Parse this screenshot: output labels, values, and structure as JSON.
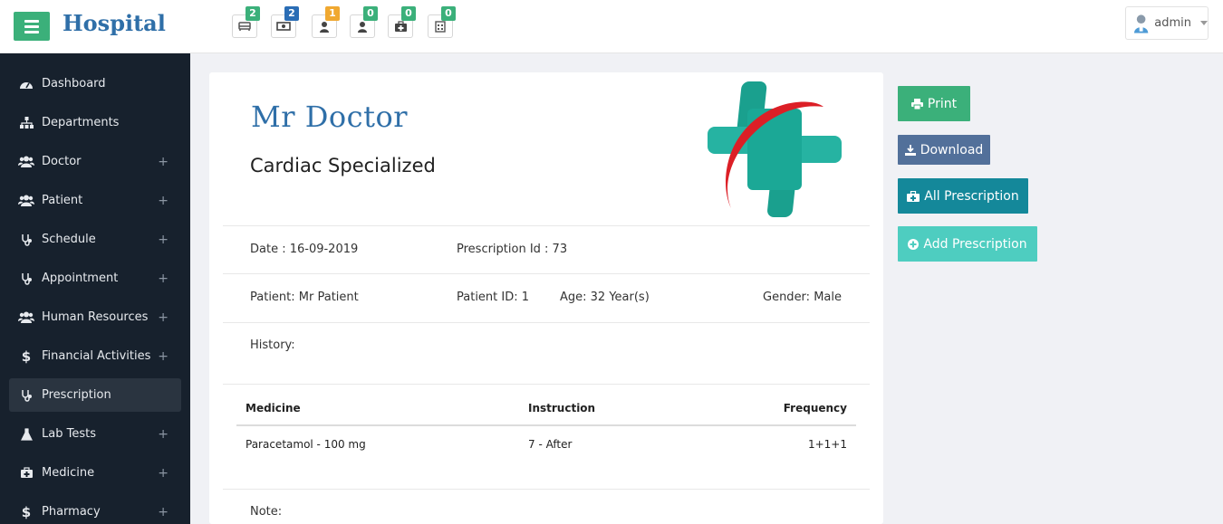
{
  "app": {
    "brand": "Hospital"
  },
  "header": {
    "badges": [
      {
        "count": "2",
        "icon": "bed-icon",
        "color": "#3bb07a"
      },
      {
        "count": "2",
        "icon": "money-icon",
        "color": "#2a6db5"
      },
      {
        "count": "1",
        "icon": "user-icon",
        "color": "#f0a830"
      },
      {
        "count": "0",
        "icon": "user-icon",
        "color": "#3bb07a"
      },
      {
        "count": "0",
        "icon": "medkit-icon",
        "color": "#3bb07a"
      },
      {
        "count": "0",
        "icon": "hospital-icon",
        "color": "#3bb07a"
      }
    ],
    "user": {
      "name": "admin"
    }
  },
  "sidebar": {
    "items": [
      {
        "label": "Dashboard",
        "icon": "dashboard-icon"
      },
      {
        "label": "Departments",
        "icon": "sitemap-icon"
      },
      {
        "label": "Doctor",
        "icon": "users-icon",
        "expandable": "+"
      },
      {
        "label": "Patient",
        "icon": "users-icon",
        "expandable": "+"
      },
      {
        "label": "Schedule",
        "icon": "stethoscope-icon",
        "expandable": "+"
      },
      {
        "label": "Appointment",
        "icon": "stethoscope-icon",
        "expandable": "+"
      },
      {
        "label": "Human Resources",
        "icon": "users-icon",
        "expandable": "+"
      },
      {
        "label": "Financial Activities",
        "icon": "dollar-icon",
        "expandable": "+"
      },
      {
        "label": "Prescription",
        "icon": "stethoscope-icon",
        "active": true
      },
      {
        "label": "Lab Tests",
        "icon": "flask-icon",
        "expandable": "+"
      },
      {
        "label": "Medicine",
        "icon": "medkit-icon",
        "expandable": "+"
      },
      {
        "label": "Pharmacy",
        "icon": "dollar-icon",
        "expandable": "+"
      }
    ]
  },
  "prescription": {
    "doctor_name": "Mr Doctor",
    "specialization": "Cardiac Specialized",
    "date": "Date : 16-09-2019",
    "prescription_id": "Prescription Id : 73",
    "patient": "Patient: Mr Patient",
    "patient_id": "Patient ID: 1",
    "age": "Age: 32 Year(s)",
    "gender": "Gender: Male",
    "history": "History:",
    "note": "Note:",
    "table": {
      "headers": [
        "Medicine",
        "Instruction",
        "Frequency"
      ],
      "rows": [
        [
          "Paracetamol - 100 mg",
          "7 - After",
          "1+1+1"
        ]
      ]
    }
  },
  "actions": {
    "print": {
      "label": "Print",
      "color": "#3bb07a"
    },
    "download": {
      "label": "Download",
      "color": "#52709a"
    },
    "all_prescription": {
      "label": "All Prescription",
      "color": "#14889a"
    },
    "add_prescription": {
      "label": "Add Prescription",
      "color": "#4ecdc0"
    }
  }
}
